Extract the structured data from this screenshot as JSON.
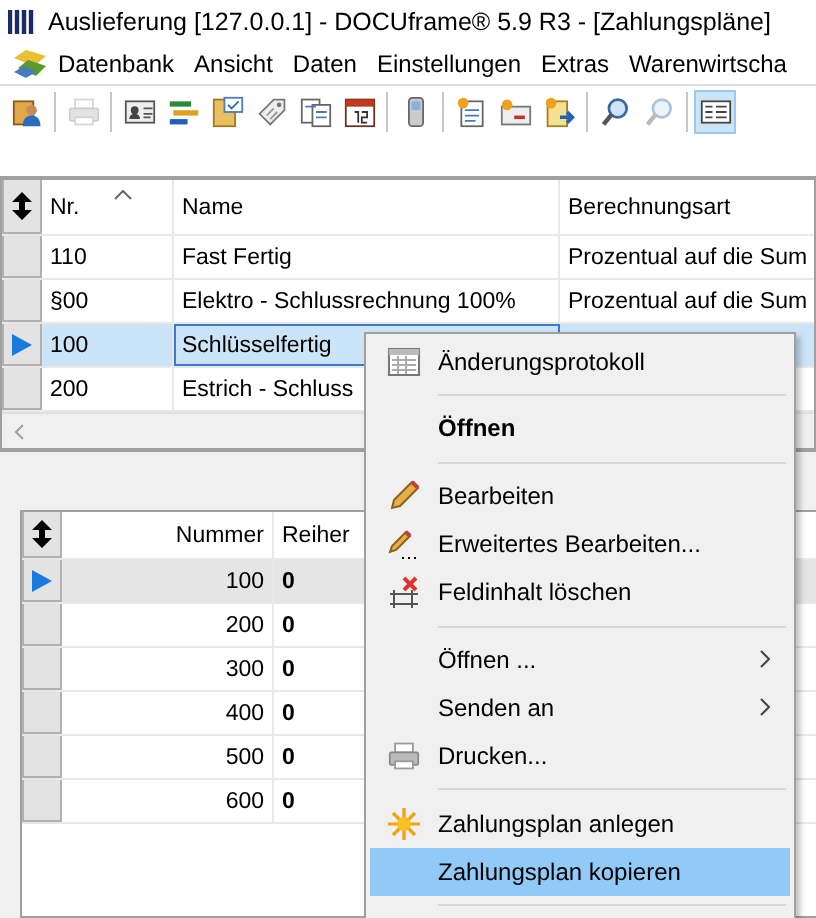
{
  "window": {
    "title": "Auslieferung [127.0.0.1] - DOCUframe® 5.9 R3 - [Zahlungspläne]"
  },
  "menu_bar": [
    {
      "label": "Datenbank"
    },
    {
      "label": "Ansicht"
    },
    {
      "label": "Daten"
    },
    {
      "label": "Einstellungen"
    },
    {
      "label": "Extras"
    },
    {
      "label": "Warenwirtscha"
    }
  ],
  "toolbar": [
    {
      "kind": "contacts",
      "disabled": false,
      "pressed": false
    },
    {
      "kind": "separator"
    },
    {
      "kind": "printer",
      "disabled": true,
      "pressed": false
    },
    {
      "kind": "separator"
    },
    {
      "kind": "card",
      "disabled": false,
      "pressed": false
    },
    {
      "kind": "bars",
      "disabled": false,
      "pressed": false
    },
    {
      "kind": "folder",
      "disabled": false,
      "pressed": false
    },
    {
      "kind": "tag",
      "disabled": false,
      "pressed": false
    },
    {
      "kind": "documents",
      "disabled": false,
      "pressed": false
    },
    {
      "kind": "calendar",
      "disabled": false,
      "pressed": false
    },
    {
      "kind": "separator"
    },
    {
      "kind": "phone",
      "disabled": false,
      "pressed": false
    },
    {
      "kind": "separator"
    },
    {
      "kind": "newdoc",
      "disabled": false,
      "pressed": false
    },
    {
      "kind": "newmail",
      "disabled": false,
      "pressed": false
    },
    {
      "kind": "export",
      "disabled": false,
      "pressed": false
    },
    {
      "kind": "separator"
    },
    {
      "kind": "search",
      "disabled": false,
      "pressed": false
    },
    {
      "kind": "search",
      "disabled": true,
      "pressed": false
    },
    {
      "kind": "separator"
    },
    {
      "kind": "view",
      "disabled": false,
      "pressed": true
    }
  ],
  "payment_plans": {
    "columns": [
      {
        "label": "Nr.",
        "sorted": true
      },
      {
        "label": "Name",
        "sorted": false
      },
      {
        "label": "Berechnungsart",
        "sorted": false
      }
    ],
    "rows": [
      {
        "cells": [
          "110",
          "Fast Fertig",
          "Prozentual auf die Sum"
        ],
        "selected": false
      },
      {
        "cells": [
          "§00",
          "Elektro - Schlussrechnung 100%",
          "Prozentual auf die Sum"
        ],
        "selected": false
      },
      {
        "cells": [
          "100",
          "Schlüsselfertig"
        ],
        "selected": true
      },
      {
        "cells": [
          "200",
          "Estrich - Schluss"
        ],
        "selected": false
      }
    ]
  },
  "plan_steps": {
    "columns": [
      {
        "label": "Nummer",
        "sorted": false
      },
      {
        "label": "Reiher",
        "sorted": false
      }
    ],
    "rows": [
      {
        "cells": [
          "100",
          "0"
        ],
        "selected": true
      },
      {
        "cells": [
          "200",
          "0"
        ],
        "selected": false
      },
      {
        "cells": [
          "300",
          "0"
        ],
        "selected": false
      },
      {
        "cells": [
          "400",
          "0"
        ],
        "selected": false
      },
      {
        "cells": [
          "500",
          "0"
        ],
        "selected": false
      },
      {
        "cells": [
          "600",
          "0"
        ],
        "selected": false
      }
    ]
  },
  "context_menu": [
    {
      "kind": "log",
      "label": "Änderungsprotokoll",
      "bold": false,
      "submenu": false,
      "selected": false
    },
    {
      "kind": "separator"
    },
    {
      "kind": "text",
      "label": "Öffnen",
      "bold": true,
      "submenu": false,
      "selected": false
    },
    {
      "kind": "separator"
    },
    {
      "kind": "pencil",
      "label": "Bearbeiten",
      "bold": false,
      "submenu": false,
      "selected": false
    },
    {
      "kind": "pencil-more",
      "label": "Erweitertes Bearbeiten...",
      "bold": false,
      "submenu": false,
      "selected": false
    },
    {
      "kind": "clear",
      "label": "Feldinhalt löschen",
      "bold": false,
      "submenu": false,
      "selected": false
    },
    {
      "kind": "separator"
    },
    {
      "kind": "text",
      "label": "Öffnen ...",
      "bold": false,
      "submenu": true,
      "selected": false
    },
    {
      "kind": "text",
      "label": "Senden an",
      "bold": false,
      "submenu": true,
      "selected": false
    },
    {
      "kind": "printer",
      "label": "Drucken...",
      "bold": false,
      "submenu": false,
      "selected": false
    },
    {
      "kind": "separator"
    },
    {
      "kind": "star",
      "label": "Zahlungsplan anlegen",
      "bold": false,
      "submenu": false,
      "selected": false
    },
    {
      "kind": "text",
      "label": "Zahlungsplan kopieren",
      "bold": false,
      "submenu": false,
      "selected": true
    },
    {
      "kind": "separator"
    }
  ]
}
